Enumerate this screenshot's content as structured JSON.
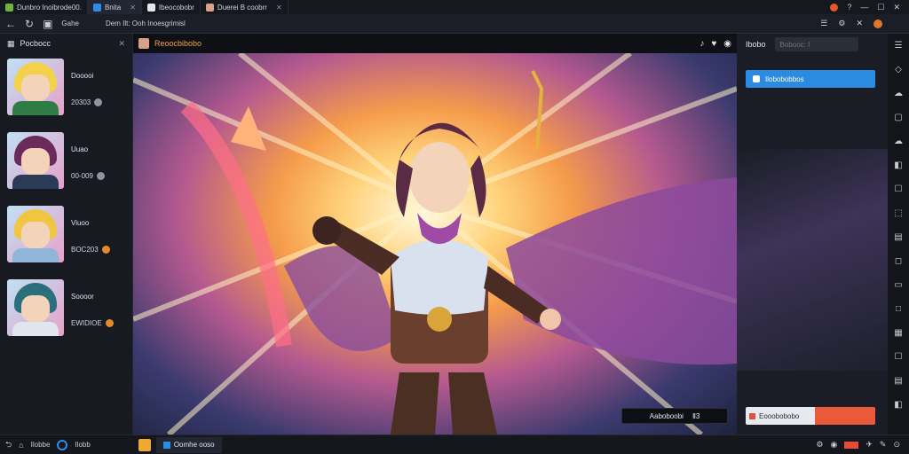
{
  "titlebar": {
    "tabs": [
      {
        "label": "Dunbro Inoibrode00.",
        "icon": "app-icon",
        "active": false
      },
      {
        "label": "Bnita",
        "icon": "window-icon",
        "active": true
      },
      {
        "label": "Ibeocobobr",
        "icon": "folder-icon",
        "active": false
      },
      {
        "label": "Duerei B coobrr",
        "icon": "image-icon",
        "active": false
      }
    ],
    "controls": {
      "help": "?",
      "minimize": "—",
      "restore": "☐",
      "close": "✕"
    }
  },
  "toolbar": {
    "back": "←",
    "refresh": "↻",
    "label": "Gahe",
    "url": "Dem Ilt: Ooh Inoesgrimisl",
    "icons": {
      "list": "☰",
      "gear": "⚙",
      "close": "✕"
    }
  },
  "left_panel": {
    "title": "Pocbocc",
    "close": "✕",
    "characters": [
      {
        "name": "Dooooi",
        "stat": "20303",
        "badge_color": "#8f949e",
        "hair": "#f2d24a",
        "outfit": "#2f7d46"
      },
      {
        "name": "Uuao",
        "stat": "00-009",
        "badge_color": "#8f949e",
        "hair": "#6a2a5a",
        "outfit": "#2b3a55"
      },
      {
        "name": "Viuoo",
        "stat": "BOC203",
        "badge_color": "#e58a2a",
        "hair": "#f0c542",
        "outfit": "#8fb6d8"
      },
      {
        "name": "Soooor",
        "stat": "EWIDIOE",
        "badge_color": "#e58a2a",
        "hair": "#2a6f7a",
        "outfit": "#dfe6ee"
      }
    ]
  },
  "viewer": {
    "title": "Reoocbibobo",
    "icons": {
      "bell": "♪",
      "heart": "♥",
      "info": "◉"
    },
    "caption_left": "Aaboboobi",
    "caption_right": "Ⅱ3"
  },
  "right_panel": {
    "header": "Ibobo",
    "search_placeholder": "Bobooc: I",
    "primary_button": "Ilobobobbos",
    "action_button": "Eooobobobo"
  },
  "side_strip": {
    "icons": [
      "☰",
      "◇",
      "☁",
      "▢",
      "☁",
      "◧",
      "☐",
      "⬚",
      "▤",
      "◻",
      "▭",
      "□",
      "▦",
      "☐",
      "▤",
      "◧"
    ]
  },
  "statusbar": {
    "back": "⮌",
    "home_label": "Ilobbe",
    "search_label": "Ilobb",
    "task_window": "Oomhe ooso",
    "tray": {
      "settings": "⚙",
      "mic": "◉",
      "time": "⊙"
    }
  }
}
